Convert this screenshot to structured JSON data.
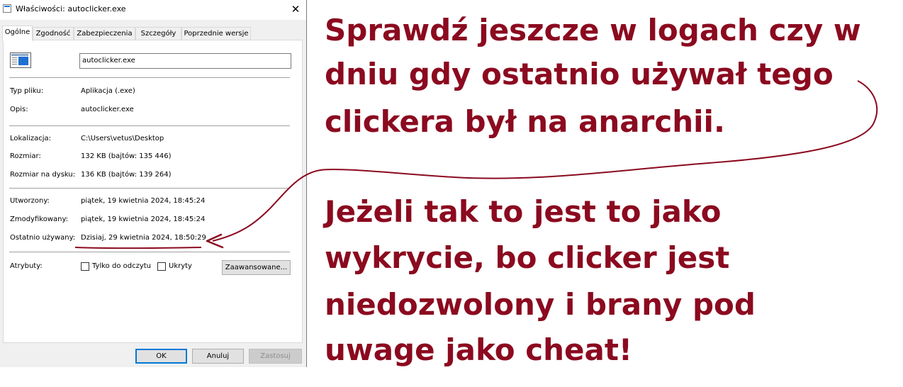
{
  "window": {
    "title": "Właściwości: autoclicker.exe",
    "close_glyph": "✕"
  },
  "tabs": [
    {
      "label": "Ogólne",
      "active": true
    },
    {
      "label": "Zgodność",
      "active": false
    },
    {
      "label": "Zabezpieczenia",
      "active": false
    },
    {
      "label": "Szczegóły",
      "active": false
    },
    {
      "label": "Poprzednie wersje",
      "active": false
    }
  ],
  "general": {
    "file_name": "autoclicker.exe",
    "file_type": {
      "label": "Typ pliku:",
      "value": "Aplikacja (.exe)"
    },
    "description": {
      "label": "Opis:",
      "value": "autoclicker.exe"
    },
    "location": {
      "label": "Lokalizacja:",
      "value": "C:\\Users\\vetus\\Desktop"
    },
    "size": {
      "label": "Rozmiar:",
      "value": "132 KB (bajtów: 135 446)"
    },
    "size_on_disk": {
      "label": "Rozmiar na dysku:",
      "value": "136 KB (bajtów: 139 264)"
    },
    "created": {
      "label": "Utworzony:",
      "value": "piątek, 19 kwietnia 2024, 18:45:24"
    },
    "modified": {
      "label": "Zmodyfikowany:",
      "value": "piątek, 19 kwietnia 2024, 18:45:24"
    },
    "accessed": {
      "label": "Ostatnio używany:",
      "value": "Dzisiaj, 29 kwietnia 2024, 18:50:29"
    },
    "attributes": {
      "label": "Atrybuty:",
      "read_only_label": "Tylko do odczytu",
      "read_only_checked": false,
      "hidden_label": "Ukryty",
      "hidden_checked": false,
      "advanced_label": "Zaawansowane..."
    }
  },
  "buttons": {
    "ok": "OK",
    "cancel": "Anuluj",
    "apply": "Zastosuj"
  },
  "annotation": {
    "color": "#8b0a1f",
    "lines_top": [
      "Sprawdź jeszcze w logach czy w",
      "dniu gdy ostatnio używał tego",
      "clickera był na anarchii."
    ],
    "lines_bottom": [
      "Jeżeli tak to jest to jako",
      "wykrycie, bo clicker jest",
      "niedozwolony i brany pod",
      "uwage jako cheat!"
    ]
  }
}
